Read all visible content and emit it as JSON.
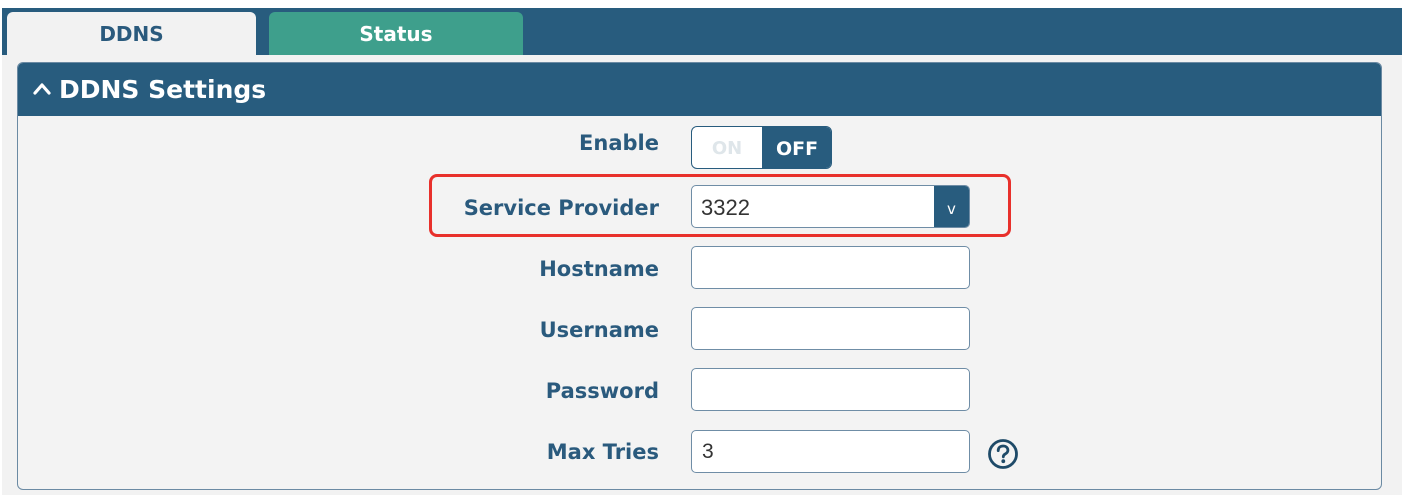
{
  "tabs": [
    {
      "label": "DDNS",
      "active": true
    },
    {
      "label": "Status",
      "active": false
    }
  ],
  "panel": {
    "title": "DDNS Settings",
    "collapse_icon": "chevron-up-icon"
  },
  "fields": {
    "enable": {
      "label": "Enable",
      "on_label": "ON",
      "off_label": "OFF",
      "state": "OFF"
    },
    "service_provider": {
      "label": "Service Provider",
      "value": "3322",
      "dropdown_icon": "v"
    },
    "hostname": {
      "label": "Hostname",
      "value": ""
    },
    "username": {
      "label": "Username",
      "value": ""
    },
    "password": {
      "label": "Password",
      "value": ""
    },
    "max_tries": {
      "label": "Max Tries",
      "value": "3",
      "help_icon": "help-icon"
    }
  },
  "colors": {
    "header": "#285c7e",
    "status_tab": "#3e9f8c",
    "label_text": "#2a5a7d",
    "highlight": "#e8302b"
  }
}
